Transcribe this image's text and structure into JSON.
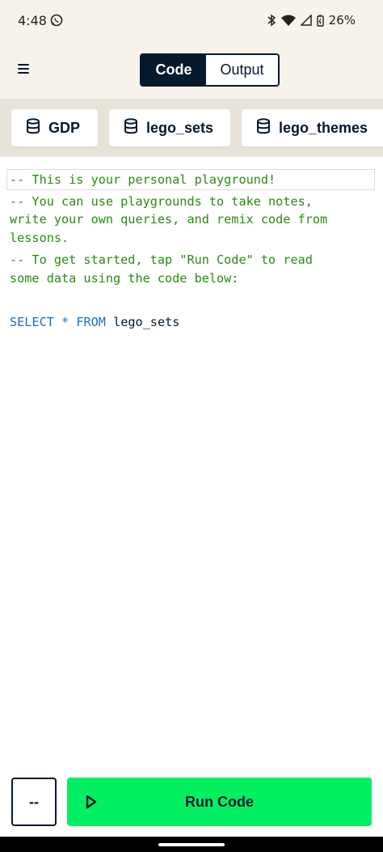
{
  "status_bar": {
    "time": "4:48",
    "battery": "26%",
    "icons": [
      "whatsapp-icon",
      "bluetooth-icon",
      "wifi-icon",
      "signal-icon",
      "battery-icon"
    ]
  },
  "header": {
    "menu_icon": "hamburger-menu-icon",
    "tabs": [
      {
        "label": "Code",
        "active": true
      },
      {
        "label": "Output",
        "active": false
      }
    ]
  },
  "datasets": [
    {
      "label": "GDP",
      "icon": "database-icon"
    },
    {
      "label": "lego_sets",
      "icon": "database-icon"
    },
    {
      "label": "lego_themes",
      "icon": "database-icon"
    }
  ],
  "editor": {
    "comments": [
      "-- This is your personal playground!",
      "-- You can use playgrounds to take notes,",
      "write your own queries, and remix code from",
      "lessons.",
      "-- To get started, tap \"Run Code\" to read",
      "some data using the code below:"
    ],
    "query": {
      "keyword_select": "SELECT",
      "operator_star": "*",
      "keyword_from": "FROM",
      "table": "lego_sets"
    }
  },
  "footer": {
    "aux_label": "--",
    "run_label": "Run Code",
    "run_icon": "play-icon"
  },
  "colors": {
    "brand_dark": "#05192d",
    "run_green": "#03ef62",
    "comment_green": "#2a8a12",
    "keyword_blue": "#1d6fbf",
    "header_bg": "#f7f3eb",
    "tabs_bg": "#e8e3d8"
  }
}
